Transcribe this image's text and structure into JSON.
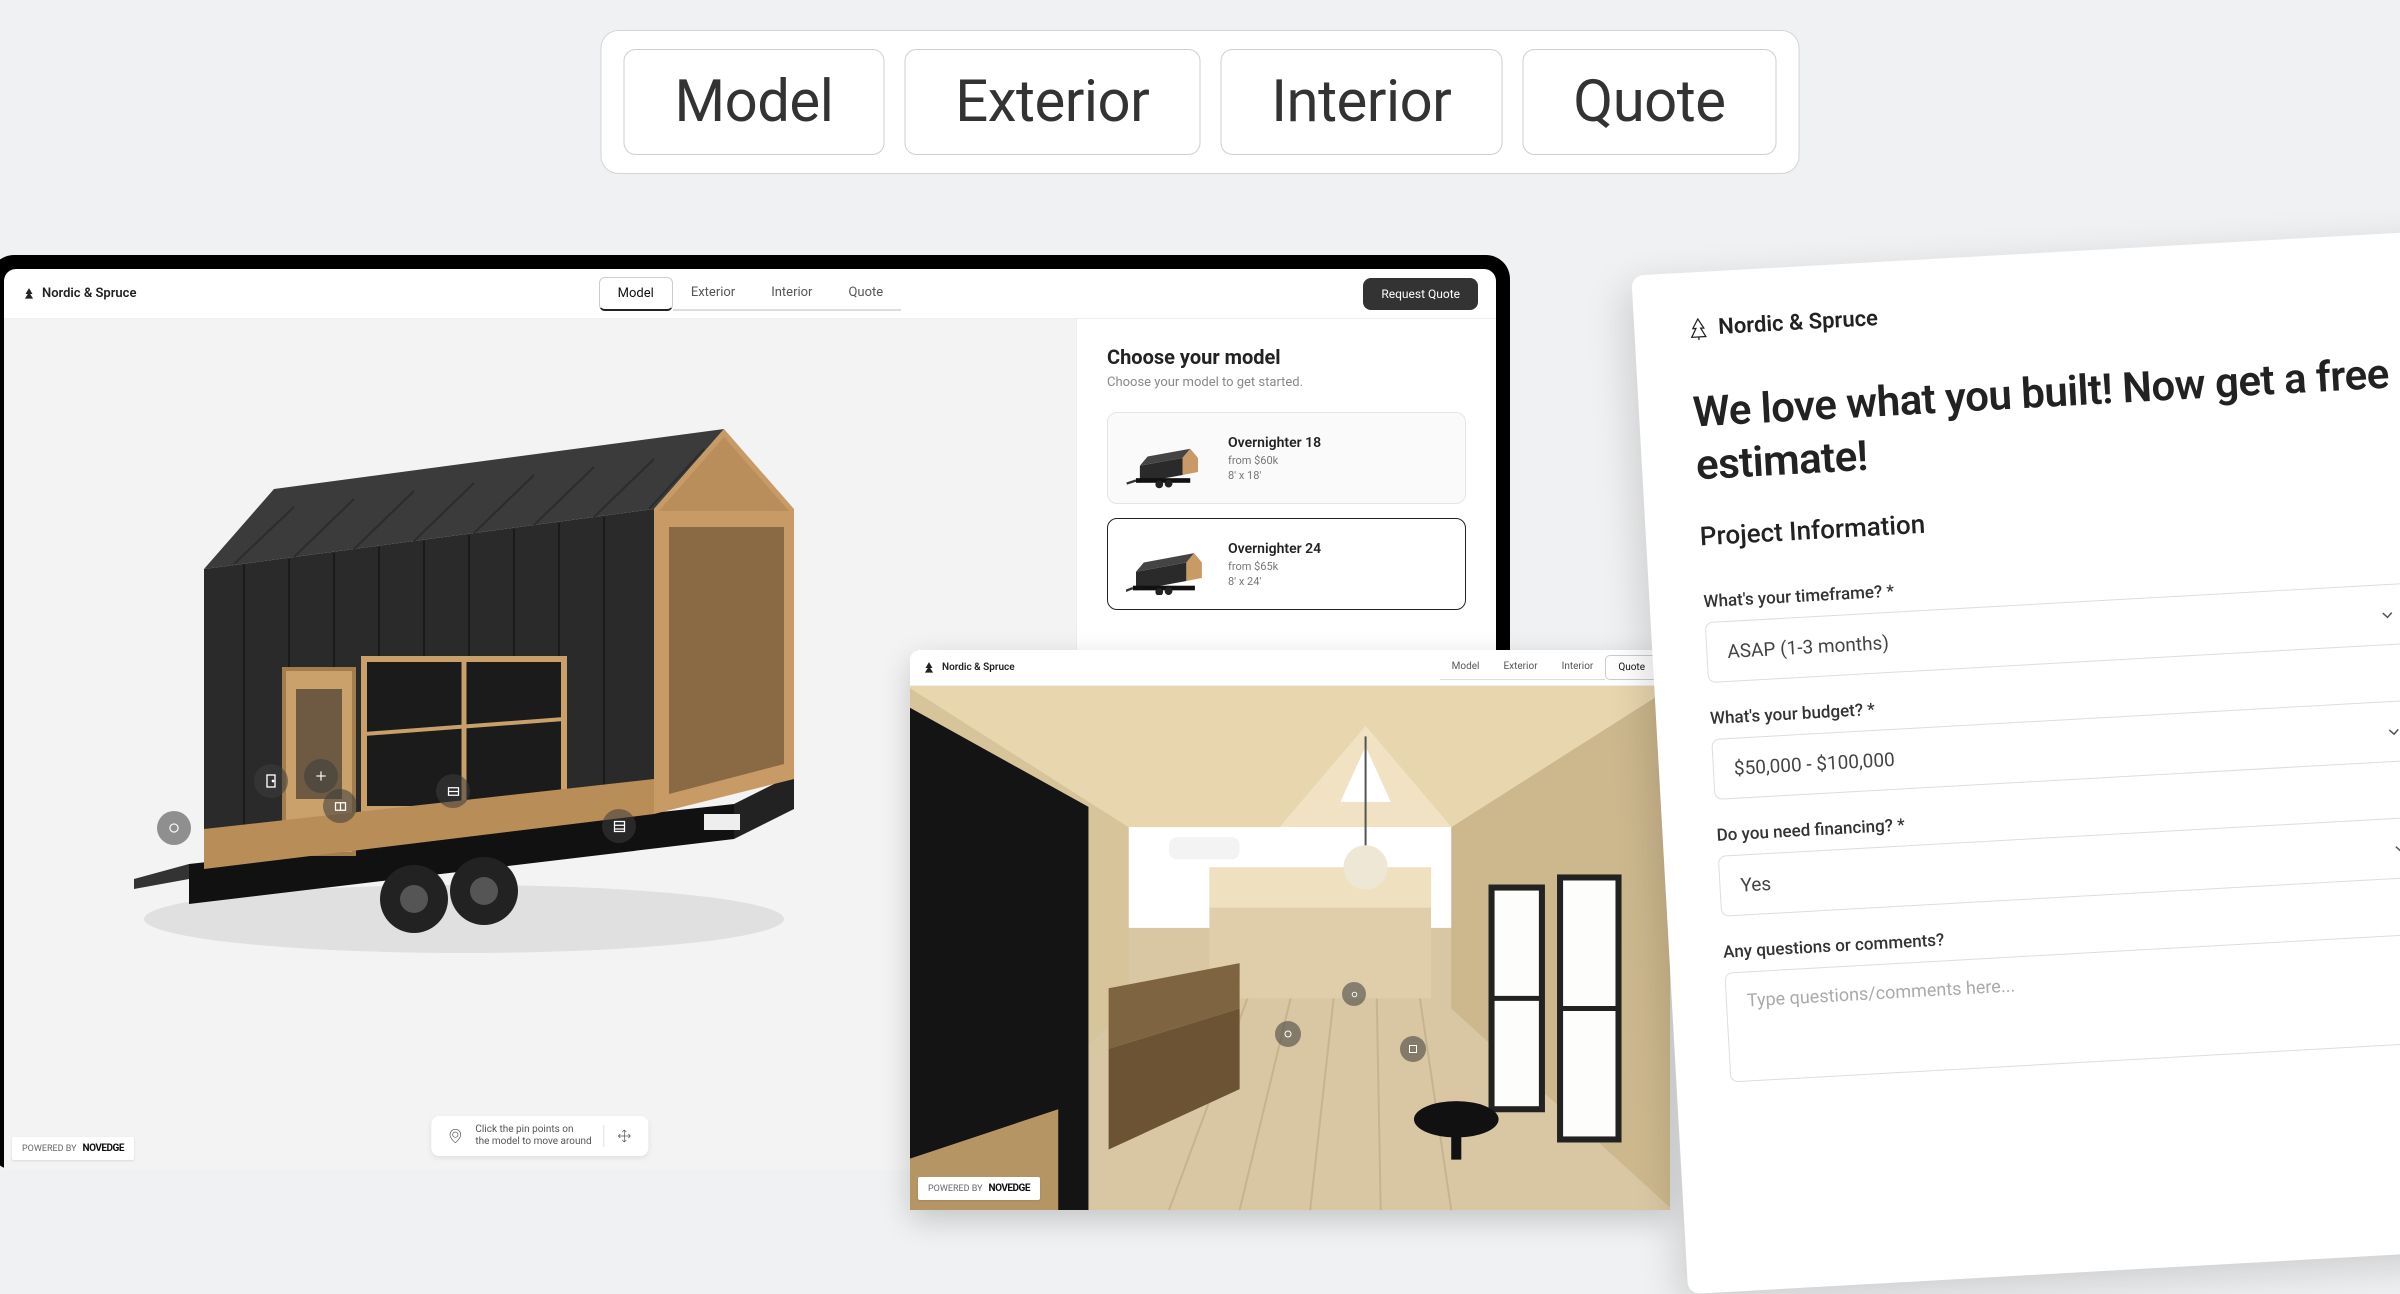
{
  "top_tabs": [
    "Model",
    "Exterior",
    "Interior",
    "Quote"
  ],
  "brand": "Nordic & Spruce",
  "desktop": {
    "tabs": [
      "Model",
      "Exterior",
      "Interior",
      "Quote"
    ],
    "active_tab_index": 0,
    "request_quote_label": "Request Quote",
    "powered_by_prefix": "POWERED BY",
    "powered_by_brand": "NOVEDGE",
    "hint_text": "Click the pin points on\nthe model to move around",
    "choose": {
      "title": "Choose your model",
      "subtitle": "Choose your model to get started.",
      "models": [
        {
          "name": "Overnighter 18",
          "price": "from $60k",
          "dims": "8' x 18'",
          "selected": false
        },
        {
          "name": "Overnighter 24",
          "price": "from $65k",
          "dims": "8' x 24'",
          "selected": true
        }
      ]
    },
    "hotspots": [
      "door-hotspot",
      "window-left-hotspot",
      "window-center-hotspot",
      "window-right-hotspot",
      "siding-hotspot",
      "trailer-hotspot"
    ]
  },
  "laptop": {
    "tabs": [
      "Model",
      "Exterior",
      "Interior",
      "Quote"
    ],
    "active_tab_index": 3
  },
  "quote": {
    "headline": "We love what you built! Now get a free estimate!",
    "section": "Project Information",
    "fields": {
      "timeframe": {
        "label": "What's your timeframe? *",
        "value": "ASAP (1-3 months)"
      },
      "budget": {
        "label": "What's your budget? *",
        "value": "$50,000 - $100,000"
      },
      "financing": {
        "label": "Do you need financing? *",
        "value": "Yes"
      },
      "comments": {
        "label": "Any questions or comments?",
        "placeholder": "Type questions/comments here..."
      }
    }
  }
}
